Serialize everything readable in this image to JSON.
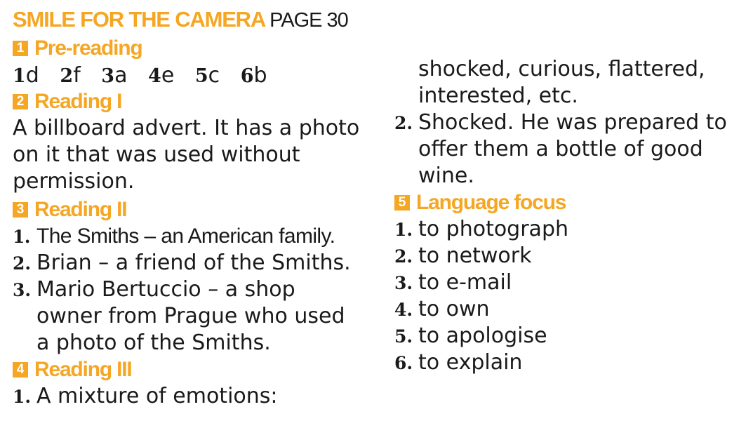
{
  "title": {
    "main": "SMILE FOR THE CAMERA",
    "page": "PAGE 30"
  },
  "sections": {
    "pre_reading": {
      "number": "1",
      "label": "Pre-reading",
      "answers": [
        {
          "n": "1",
          "l": "d"
        },
        {
          "n": "2",
          "l": "f"
        },
        {
          "n": "3",
          "l": "a"
        },
        {
          "n": "4",
          "l": "e"
        },
        {
          "n": "5",
          "l": "c"
        },
        {
          "n": "6",
          "l": "b"
        }
      ]
    },
    "reading1": {
      "number": "2",
      "label": "Reading I",
      "lines": [
        "A billboard advert. It has a photo",
        "on it that was used without",
        "permission."
      ]
    },
    "reading2": {
      "number": "3",
      "label": "Reading II",
      "items": [
        {
          "num": "1.",
          "lines": [
            "The Smiths – an American family."
          ]
        },
        {
          "num": "2.",
          "lines": [
            "Brian – a friend of the Smiths."
          ]
        },
        {
          "num": "3.",
          "lines": [
            "Mario Bertuccio – a shop",
            "owner from Prague who used",
            "a photo of the Smiths."
          ]
        }
      ]
    },
    "reading3": {
      "number": "4",
      "label": "Reading III",
      "item1": {
        "num": "1.",
        "text": "A mixture of emotions:"
      },
      "item1_cont": [
        "shocked, curious, flattered,",
        "interested, etc."
      ],
      "item2": {
        "num": "2.",
        "lines": [
          "Shocked. He was prepared to",
          "offer them a bottle of good",
          "wine."
        ]
      }
    },
    "language_focus": {
      "number": "5",
      "label": "Language focus",
      "items": [
        {
          "num": "1.",
          "text": "to photograph"
        },
        {
          "num": "2.",
          "text": "to network"
        },
        {
          "num": "3.",
          "text": "to e-mail"
        },
        {
          "num": "4.",
          "text": "to own"
        },
        {
          "num": "5.",
          "text": "to apologise"
        },
        {
          "num": "6.",
          "text": "to explain"
        }
      ]
    }
  }
}
